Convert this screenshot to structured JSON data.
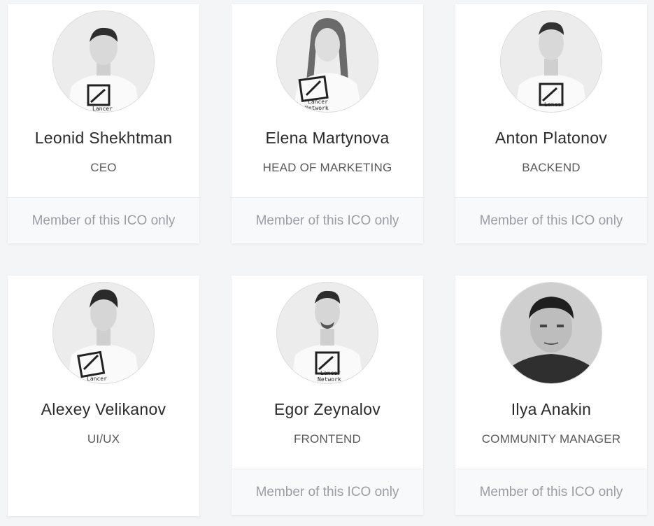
{
  "members": [
    {
      "name": "Leonid Shekhtman",
      "role": "CEO",
      "footer": "Member of this ICO only"
    },
    {
      "name": "Elena Martynova",
      "role": "HEAD OF MARKETING",
      "footer": "Member of this ICO only"
    },
    {
      "name": "Anton Platonov",
      "role": "BACKEND",
      "footer": "Member of this ICO only"
    },
    {
      "name": "Alexey Velikanov",
      "role": "UI/UX",
      "footer": ""
    },
    {
      "name": "Egor Zeynalov",
      "role": "FRONTEND",
      "footer": "Member of this ICO only"
    },
    {
      "name": "Ilya Anakin",
      "role": "COMMUNITY MANAGER",
      "footer": "Member of this ICO only"
    }
  ],
  "shirt_text": [
    "Lancer",
    "Network"
  ]
}
